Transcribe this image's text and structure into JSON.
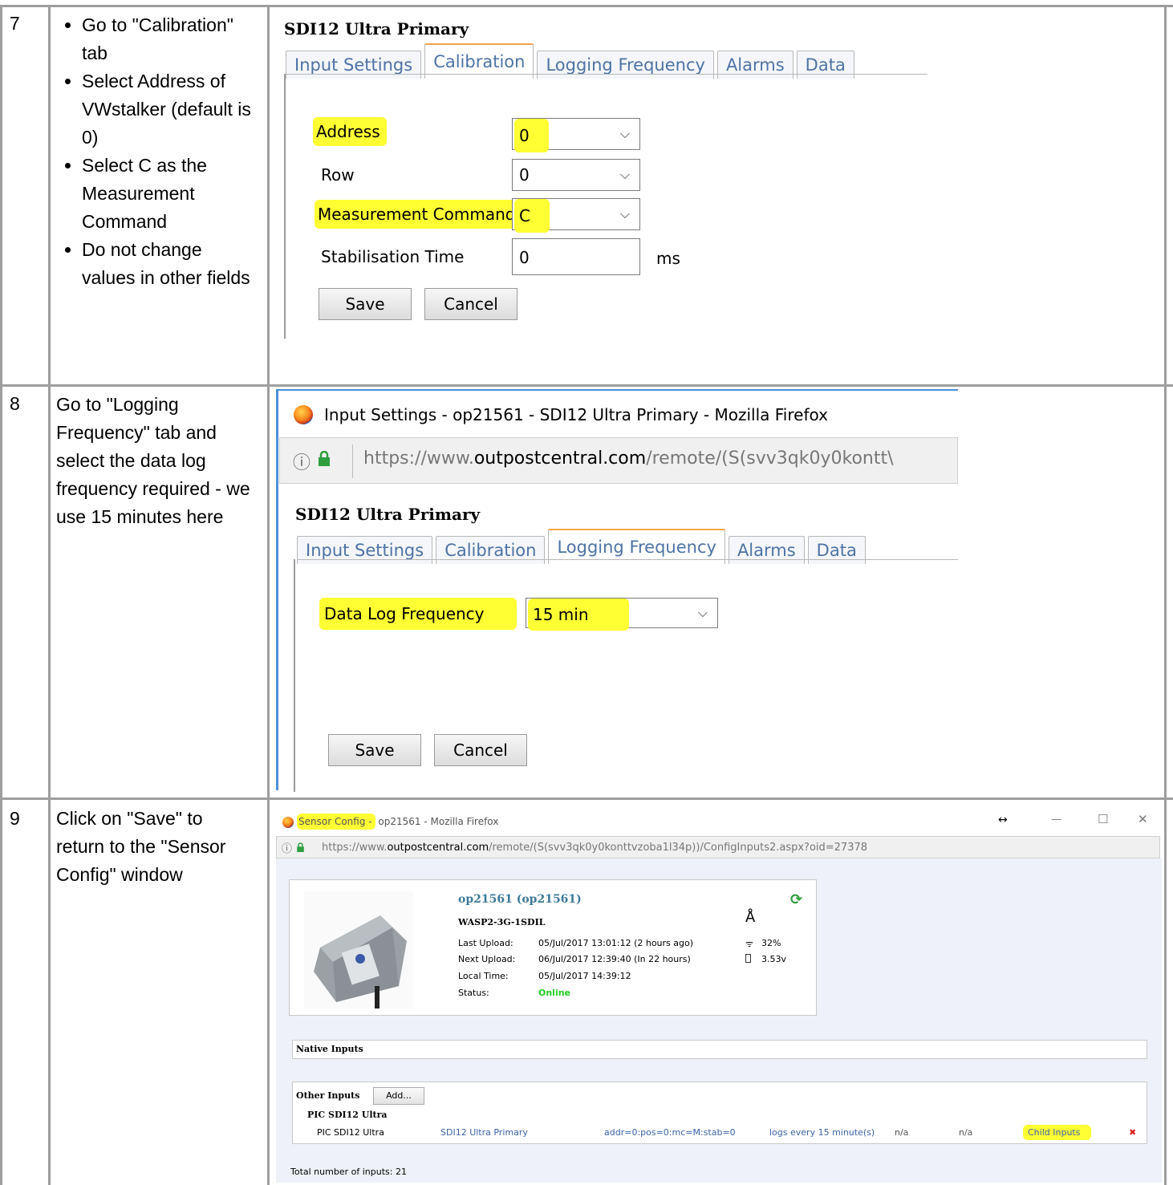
{
  "rows": [
    {
      "number": "7",
      "bullets": [
        "Go to \"Calibration\" tab",
        "Select Address of VWstalker (default is 0)",
        "Select C as the Measurement Command",
        "Do not change values in other fields"
      ]
    },
    {
      "number": "8",
      "text": "Go to \"Logging Frequency\" tab and select the data log frequency required - we use 15 minutes here"
    },
    {
      "number": "9",
      "text": "Click on \"Save\" to return to the \"Sensor Config\" window"
    }
  ],
  "shot7": {
    "title": "SDI12 Ultra Primary",
    "tabs": [
      "Input Settings",
      "Calibration",
      "Logging Frequency",
      "Alarms",
      "Data"
    ],
    "active_tab": "Calibration",
    "fields": {
      "address_label": "Address",
      "address_value": "0",
      "row_label": "Row",
      "row_value": "0",
      "command_label": "Measurement Command",
      "command_value": "C",
      "stab_label": "Stabilisation Time",
      "stab_value": "0",
      "stab_unit": "ms"
    },
    "save_label": "Save",
    "cancel_label": "Cancel",
    "highlight_color": "#ffff33"
  },
  "shot8": {
    "window_title": "Input Settings - op21561 - SDI12 Ultra Primary - Mozilla Firefox",
    "url_prefix": "https://www.",
    "url_domain": "outpostcentral.com",
    "url_rest": "/remote/(S(svv3qk0y0kontt\\",
    "title": "SDI12 Ultra Primary",
    "tabs": [
      "Input Settings",
      "Calibration",
      "Logging Frequency",
      "Alarms",
      "Data"
    ],
    "active_tab": "Logging Frequency",
    "freq_label": "Data Log Frequency",
    "freq_value": "15 min",
    "save_label": "Save",
    "cancel_label": "Cancel"
  },
  "shot9": {
    "window_title_highlight": "Sensor Config -",
    "window_title_rest": " op21561 - Mozilla Firefox",
    "window_controls": [
      "↔",
      "—",
      "☐",
      "✕"
    ],
    "url_prefix": "https://www.",
    "url_domain": "outpostcentral.com",
    "url_rest": "/remote/(S(svv3qk0y0konttvzoba1l34p))/ConfigInputs2.aspx?oid=27378",
    "device_name": "op21561 (op21561)",
    "device_model": "WASP2-3G-1SDIL",
    "info": [
      {
        "label": "Last Upload:",
        "value": "05/Jul/2017 13:01:12 (2 hours ago)"
      },
      {
        "label": "Next Upload:",
        "value": "06/Jul/2017 12:39:40 (In 22 hours)"
      },
      {
        "label": "Local Time:",
        "value": "05/Jul/2017 14:39:12"
      },
      {
        "label": "Status:",
        "value": "Online"
      }
    ],
    "signal": "32%",
    "battery": "3.53v",
    "native_inputs_title": "Native Inputs",
    "other_inputs_title": "Other Inputs",
    "add_button": "Add...",
    "group_title": "PIC SDI12 Ultra",
    "input_row": {
      "type": "PIC SDI12 Ultra",
      "name": "SDI12 Ultra Primary",
      "params": "addr=0:pos=0:mc=M:stab=0",
      "logs": "logs every 15 minute(s)",
      "na1": "n/a",
      "na2": "n/a",
      "child_inputs": "Child Inputs",
      "delete": "✖"
    },
    "total": "Total number of inputs: 21"
  }
}
